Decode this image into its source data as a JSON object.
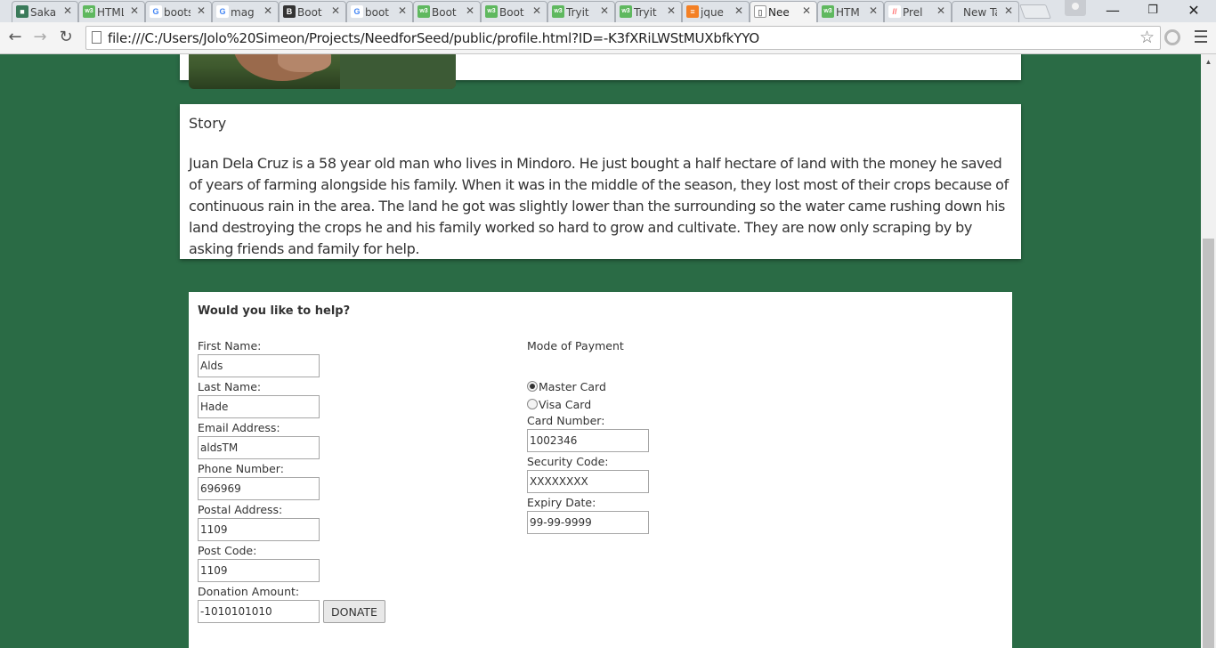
{
  "browser": {
    "tabs": [
      {
        "label": "Saka",
        "favicon_color": "#3a7a5a",
        "favicon_glyph": "■"
      },
      {
        "label": "HTML",
        "favicon_color": "#5fb85f",
        "favicon_glyph": "w3"
      },
      {
        "label": "boots",
        "favicon_color": "#ffffff",
        "favicon_glyph": "G"
      },
      {
        "label": "mag",
        "favicon_color": "#ffffff",
        "favicon_glyph": "G"
      },
      {
        "label": "Boot",
        "favicon_color": "#333333",
        "favicon_glyph": "B"
      },
      {
        "label": "boot",
        "favicon_color": "#ffffff",
        "favicon_glyph": "G"
      },
      {
        "label": "Boot",
        "favicon_color": "#5fb85f",
        "favicon_glyph": "w3"
      },
      {
        "label": "Boot",
        "favicon_color": "#5fb85f",
        "favicon_glyph": "w3"
      },
      {
        "label": "Tryit",
        "favicon_color": "#5fb85f",
        "favicon_glyph": "w3"
      },
      {
        "label": "Tryit",
        "favicon_color": "#5fb85f",
        "favicon_glyph": "w3"
      },
      {
        "label": "jque",
        "favicon_color": "#f48024",
        "favicon_glyph": "≡"
      },
      {
        "label": "Nee",
        "favicon_color": "#ffffff",
        "favicon_glyph": "▯",
        "active": true
      },
      {
        "label": "HTM",
        "favicon_color": "#5fb85f",
        "favicon_glyph": "w3"
      },
      {
        "label": "Prel",
        "favicon_color": "#ff6b6b",
        "favicon_glyph": "//"
      },
      {
        "label": "New Ta",
        "favicon_color": "",
        "favicon_glyph": ""
      }
    ],
    "url": "file:///C:/Users/Jolo%20Simeon/Projects/NeedforSeed/public/profile.html?ID=-K3fXRiLWStMUXbfkYYO",
    "window_controls": {
      "minimize": "—",
      "restore": "❐",
      "close": "✕"
    },
    "nav": {
      "back": "←",
      "forward": "→",
      "reload": "↻",
      "star": "☆"
    }
  },
  "story": {
    "title": "Story",
    "text": "Juan Dela Cruz is a 58 year old man who lives in Mindoro. He just bought a half hectare of land with the money he saved of years of farming alongside his family. When it was in the middle of the season, they lost most of their crops because of continuous rain in the area. The land he got was slightly lower than the surrounding so the water came rushing down his land destroying the crops he and his family worked so hard to grow and cultivate. They are now only scraping by by asking friends and family for help."
  },
  "help_form": {
    "title": "Would you like to help?",
    "first_name": {
      "label": "First Name:",
      "value": "Alds"
    },
    "last_name": {
      "label": "Last Name:",
      "value": "Hade"
    },
    "email": {
      "label": "Email Address:",
      "value": "aldsTM"
    },
    "phone": {
      "label": "Phone Number:",
      "value": "696969"
    },
    "postal_address": {
      "label": "Postal Address:",
      "value": "1109"
    },
    "post_code": {
      "label": "Post Code:",
      "value": "1109"
    },
    "donation": {
      "label": "Donation Amount:",
      "value": "-1010101010"
    },
    "donate_button": "DONATE",
    "payment": {
      "title": "Mode of Payment",
      "options": [
        "Master Card",
        "Visa Card"
      ],
      "selected": "Master Card",
      "card_number": {
        "label": "Card Number:",
        "value": "1002346"
      },
      "security_code": {
        "label": "Security Code:",
        "value": "XXXXXXXX"
      },
      "expiry_date": {
        "label": "Expiry Date:",
        "value": "99-99-9999"
      }
    }
  }
}
